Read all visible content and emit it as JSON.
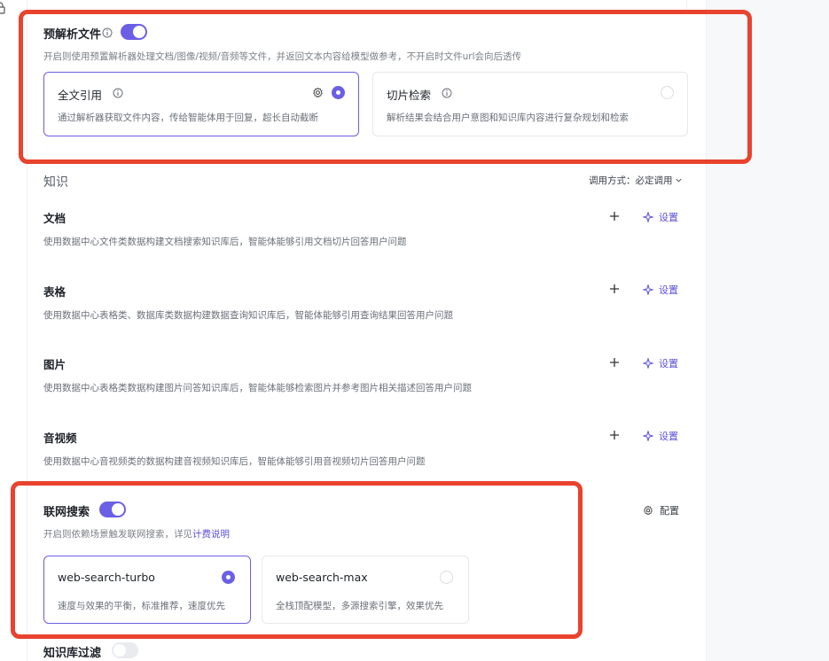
{
  "colors": {
    "accent": "#6b5fe6",
    "highlight": "#e8432e"
  },
  "preparse": {
    "title": "预解析文件",
    "description": "开启则使用预置解析器处理文档/图像/视频/音频等文件，并返回文本内容给模型做参考，不开启时文件url会向后透传",
    "toggle_on": true,
    "options": [
      {
        "title": "全文引用",
        "description": "通过解析器获取文件内容，传给智能体用于回复，超长自动截断",
        "selected": true
      },
      {
        "title": "切片检索",
        "description": "解析结果会结合用户意图和知识库内容进行复杂规划和检索",
        "selected": false
      }
    ]
  },
  "knowledge": {
    "title": "知识",
    "call_mode_label": "调用方式：",
    "call_mode_value": "必定调用",
    "items": [
      {
        "title": "文档",
        "description": "使用数据中心文件类数据构建文档搜索知识库后，智能体能够引用文档切片回答用户问题",
        "setting_label": "设置"
      },
      {
        "title": "表格",
        "description": "使用数据中心表格类、数据库类数据构建数据查询知识库后，智能体能够引用查询结果回答用户问题",
        "setting_label": "设置"
      },
      {
        "title": "图片",
        "description": "使用数据中心表格类数据构建图片问答知识库后，智能体能够检索图片并参考图片相关描述回答用户问题",
        "setting_label": "设置"
      },
      {
        "title": "音视频",
        "description": "使用数据中心音视频类的数据构建音视频知识库后，智能体能够引用音视频切片回答用户问题",
        "setting_label": "设置"
      }
    ]
  },
  "web_search": {
    "title": "联网搜索",
    "toggle_on": true,
    "config_label": "配置",
    "description_prefix": "开启则依赖场景触发联网搜索，详见",
    "pricing_link": "计费说明",
    "options": [
      {
        "title": "web-search-turbo",
        "description": "速度与效果的平衡，标准推荐，速度优先",
        "selected": true
      },
      {
        "title": "web-search-max",
        "description": "全栈顶配模型，多源搜索引擎，效果优先",
        "selected": false
      }
    ]
  },
  "kb_filter": {
    "title": "知识库过滤",
    "toggle_on": false
  }
}
